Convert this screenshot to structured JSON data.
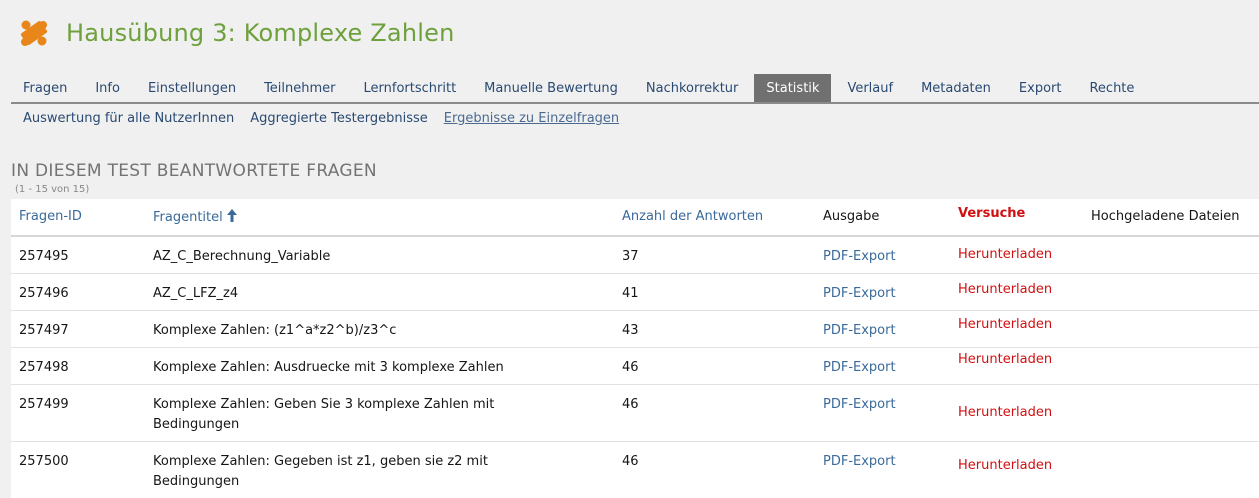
{
  "header": {
    "title": "Hausübung 3: Komplexe Zahlen",
    "icon": "puzzle-icon",
    "icon_color": "#e8861a"
  },
  "tabs": [
    {
      "label": "Fragen"
    },
    {
      "label": "Info"
    },
    {
      "label": "Einstellungen"
    },
    {
      "label": "Teilnehmer"
    },
    {
      "label": "Lernfortschritt"
    },
    {
      "label": "Manuelle Bewertung"
    },
    {
      "label": "Nachkorrektur"
    },
    {
      "label": "Statistik",
      "active": true
    },
    {
      "label": "Verlauf"
    },
    {
      "label": "Metadaten"
    },
    {
      "label": "Export"
    },
    {
      "label": "Rechte"
    }
  ],
  "subtabs": [
    {
      "label": "Auswertung für alle NutzerInnen"
    },
    {
      "label": "Aggregierte Testergebnisse"
    },
    {
      "label": "Ergebnisse zu Einzelfragen",
      "active": true
    }
  ],
  "section": {
    "title": "IN DIESEM TEST BEANTWORTETE FRAGEN",
    "range": "(1 - 15 von 15)"
  },
  "table": {
    "columns": {
      "id": "Fragen-ID",
      "title": "Fragentitel",
      "answers": "Anzahl der Antworten",
      "output": "Ausgabe",
      "attempts": "Versuche",
      "uploads": "Hochgeladene Dateien"
    },
    "rows": [
      {
        "id": "257495",
        "title": "AZ_C_Berechnung_Variable",
        "answers": "37",
        "output": "PDF-Export",
        "attempts": "Herunterladen"
      },
      {
        "id": "257496",
        "title": "AZ_C_LFZ_z4",
        "answers": "41",
        "output": "PDF-Export",
        "attempts": "Herunterladen"
      },
      {
        "id": "257497",
        "title": "Komplexe Zahlen: (z1^a*z2^b)/z3^c",
        "answers": "43",
        "output": "PDF-Export",
        "attempts": "Herunterladen"
      },
      {
        "id": "257498",
        "title": "Komplexe Zahlen: Ausdruecke mit 3 komplexe Zahlen",
        "answers": "46",
        "output": "PDF-Export",
        "attempts": "Herunterladen"
      },
      {
        "id": "257499",
        "title": "Komplexe Zahlen: Geben Sie 3 komplexe Zahlen mit Bedingungen",
        "answers": "46",
        "output": "PDF-Export",
        "attempts": "Herunterladen"
      },
      {
        "id": "257500",
        "title": "Komplexe Zahlen: Gegeben ist z1, geben sie z2 mit Bedingungen",
        "answers": "46",
        "output": "PDF-Export",
        "attempts": "Herunterladen"
      }
    ]
  }
}
